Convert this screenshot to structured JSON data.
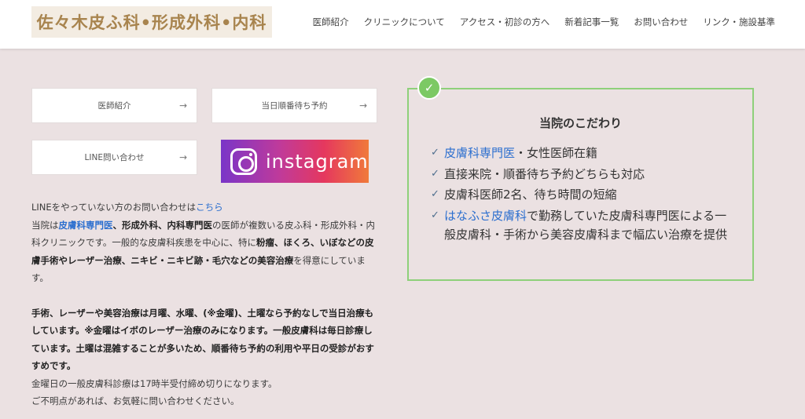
{
  "header": {
    "logo_text": "佐々木皮ふ科•形成外科•内科",
    "nav": [
      "医師紹介",
      "クリニックについて",
      "アクセス・初診の方へ",
      "新着記事一覧",
      "お問い合わせ",
      "リンク・施設基準"
    ]
  },
  "buttons": {
    "doctor": "医師紹介",
    "reserve": "当日順番待ち予約",
    "line": "LINE問い合わせ",
    "arrow": "→"
  },
  "instagram": {
    "word": "instagram",
    "icon": "instagram-camera-icon"
  },
  "text": {
    "line1_prefix": "LINEをやっていない方のお問い合わせは",
    "line1_link": "こちら",
    "p1_a": "当院は",
    "p1_link": "皮膚科専門医",
    "p1_b": "、",
    "p1_c": "形成外科",
    "p1_d": "、",
    "p1_e": "内科専門医",
    "p1_f": "の医師が複数いる皮ふ科・形成外科・内科クリニックです。一般的な皮膚科疾患を中心に、特に",
    "p1_g": "粉瘤",
    "p1_h": "、",
    "p1_i": "ほくろ",
    "p1_j": "、",
    "p1_k": "いぼなどの皮膚手術やレーザー治療",
    "p1_l": "、",
    "p1_m": "ニキビ・ニキビ跡・毛穴などの美容治療",
    "p1_n": "を得意にしています。",
    "p2_bold": "手術、レーザーや美容治療は月曜、水曜、(※金曜)、土曜なら予約なしで当日治療もしています。※金曜はイボのレーザー治療のみになります。一般皮膚科は毎日診療しています。土曜は混雑することが多いため、順番待ち予約の利用や平日の受診がおすすめです。",
    "p2_line2": "金曜日の一般皮膚科診療は17時半受付締め切りになります。",
    "p2_line3": "ご不明点があれば、お気軽に問い合わせください。"
  },
  "features": {
    "title": "当院のこだわり",
    "items": [
      {
        "link": "皮膚科専門医",
        "text": "・女性医師在籍"
      },
      {
        "link": "",
        "text": "直接来院・順番待ち予約どちらも対応"
      },
      {
        "link": "",
        "text": "皮膚科医師2名、待ち時間の短縮"
      },
      {
        "link": "はなふさ皮膚科",
        "text": "で勤務していた皮膚科専門医による一般皮膚科・手術から美容皮膚科まで幅広い治療を提供"
      }
    ]
  },
  "colors": {
    "background": "#ebe1e2",
    "accent_green": "#8ed07a",
    "link_blue": "#2c6fcf",
    "logo_gold": "#a8844e"
  }
}
